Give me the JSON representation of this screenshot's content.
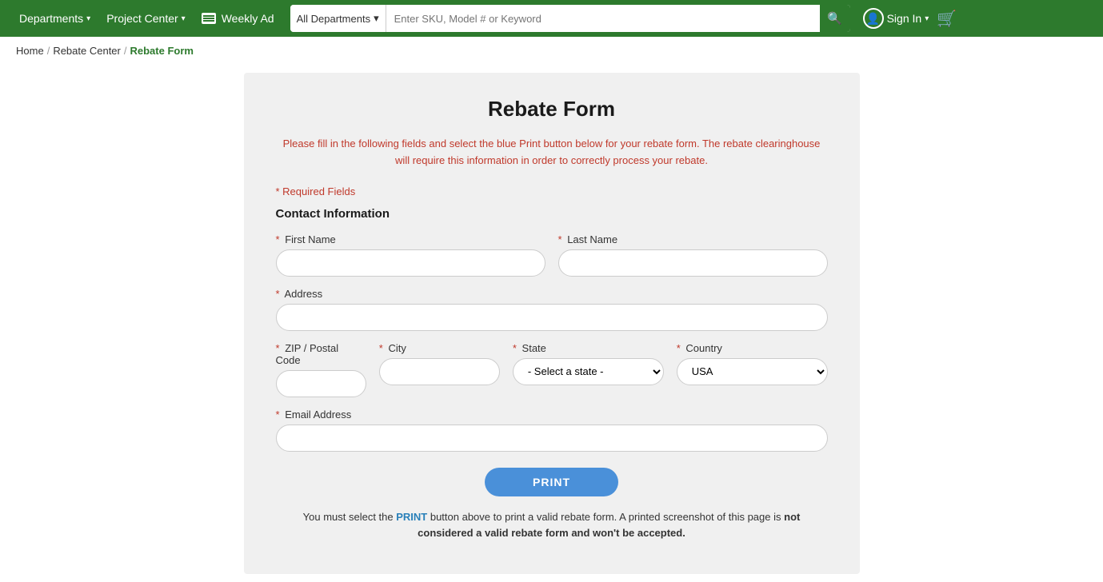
{
  "header": {
    "departments_label": "Departments",
    "project_center_label": "Project Center",
    "weekly_ad_label": "Weekly Ad",
    "search_dept_label": "All Departments",
    "search_placeholder": "Enter SKU, Model # or Keyword",
    "sign_in_label": "Sign In",
    "cart_label": "Cart"
  },
  "breadcrumb": {
    "home": "Home",
    "rebate_center": "Rebate Center",
    "current": "Rebate Form"
  },
  "form": {
    "title": "Rebate Form",
    "instructions": "Please fill in the following fields and select the blue Print button below for your rebate form. The rebate clearinghouse will require this information in order to correctly process your rebate.",
    "required_note": "* Required Fields",
    "section_title": "Contact Information",
    "fields": {
      "first_name_label": "First Name",
      "last_name_label": "Last Name",
      "address_label": "Address",
      "zip_label": "ZIP / Postal Code",
      "city_label": "City",
      "state_label": "State",
      "state_placeholder": "- Select a state -",
      "country_label": "Country",
      "country_default": "USA",
      "email_label": "Email Address"
    },
    "print_button": "PRINT",
    "print_note": "You must select the blue PRINT button above to print a valid rebate form. A printed screenshot of this page is not considered a valid rebate form and won't be accepted."
  }
}
